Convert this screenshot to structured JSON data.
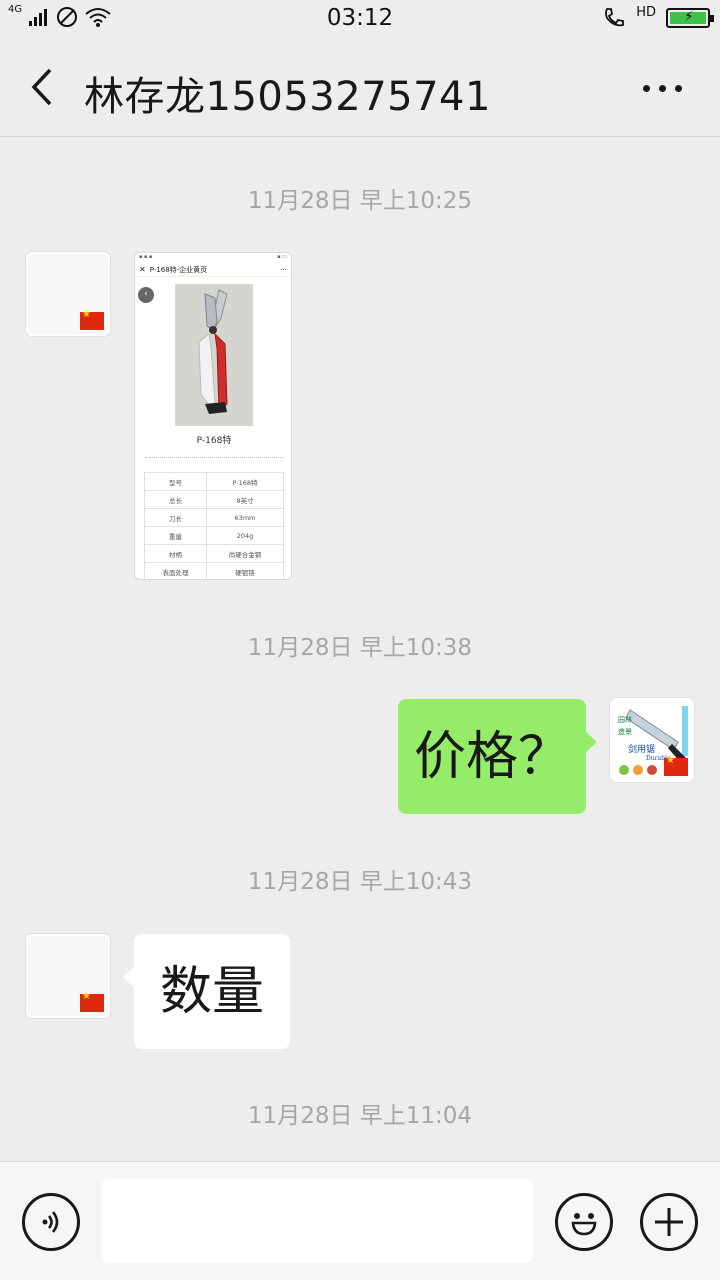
{
  "status_bar": {
    "network": "4G",
    "time": "03:12",
    "hd": "HD"
  },
  "header": {
    "title": "林存龙15053275741"
  },
  "messages": [
    {
      "kind": "timestamp",
      "text": "11月28日 早上10:25"
    },
    {
      "kind": "image",
      "side": "left",
      "screenshot": {
        "title": "P-168特-企业黄页",
        "product_caption": "P-168特",
        "table": [
          [
            "型号",
            "P-168特"
          ],
          [
            "总长",
            "8英寸"
          ],
          [
            "刀长",
            "63mm"
          ],
          [
            "重量",
            "204g"
          ],
          [
            "材柄",
            "尚硬合金钢"
          ],
          [
            "表面处理",
            "硬镀铬"
          ]
        ]
      }
    },
    {
      "kind": "timestamp",
      "text": "11月28日 早上10:38"
    },
    {
      "kind": "text",
      "side": "right",
      "text": "价格？"
    },
    {
      "kind": "timestamp",
      "text": "11月28日 早上10:43"
    },
    {
      "kind": "text",
      "side": "left",
      "text": "数量"
    },
    {
      "kind": "timestamp",
      "text": "11月28日 早上11:04"
    }
  ],
  "sticker_avatar": {
    "label": "Durable"
  },
  "input_bar": {
    "voice_icon": "voice-icon",
    "emoji_icon": "emoji-icon",
    "plus_icon": "plus-icon"
  },
  "colors": {
    "outgoing_bubble": "#95ec69",
    "incoming_bubble": "#ffffff",
    "background": "#ededed"
  }
}
